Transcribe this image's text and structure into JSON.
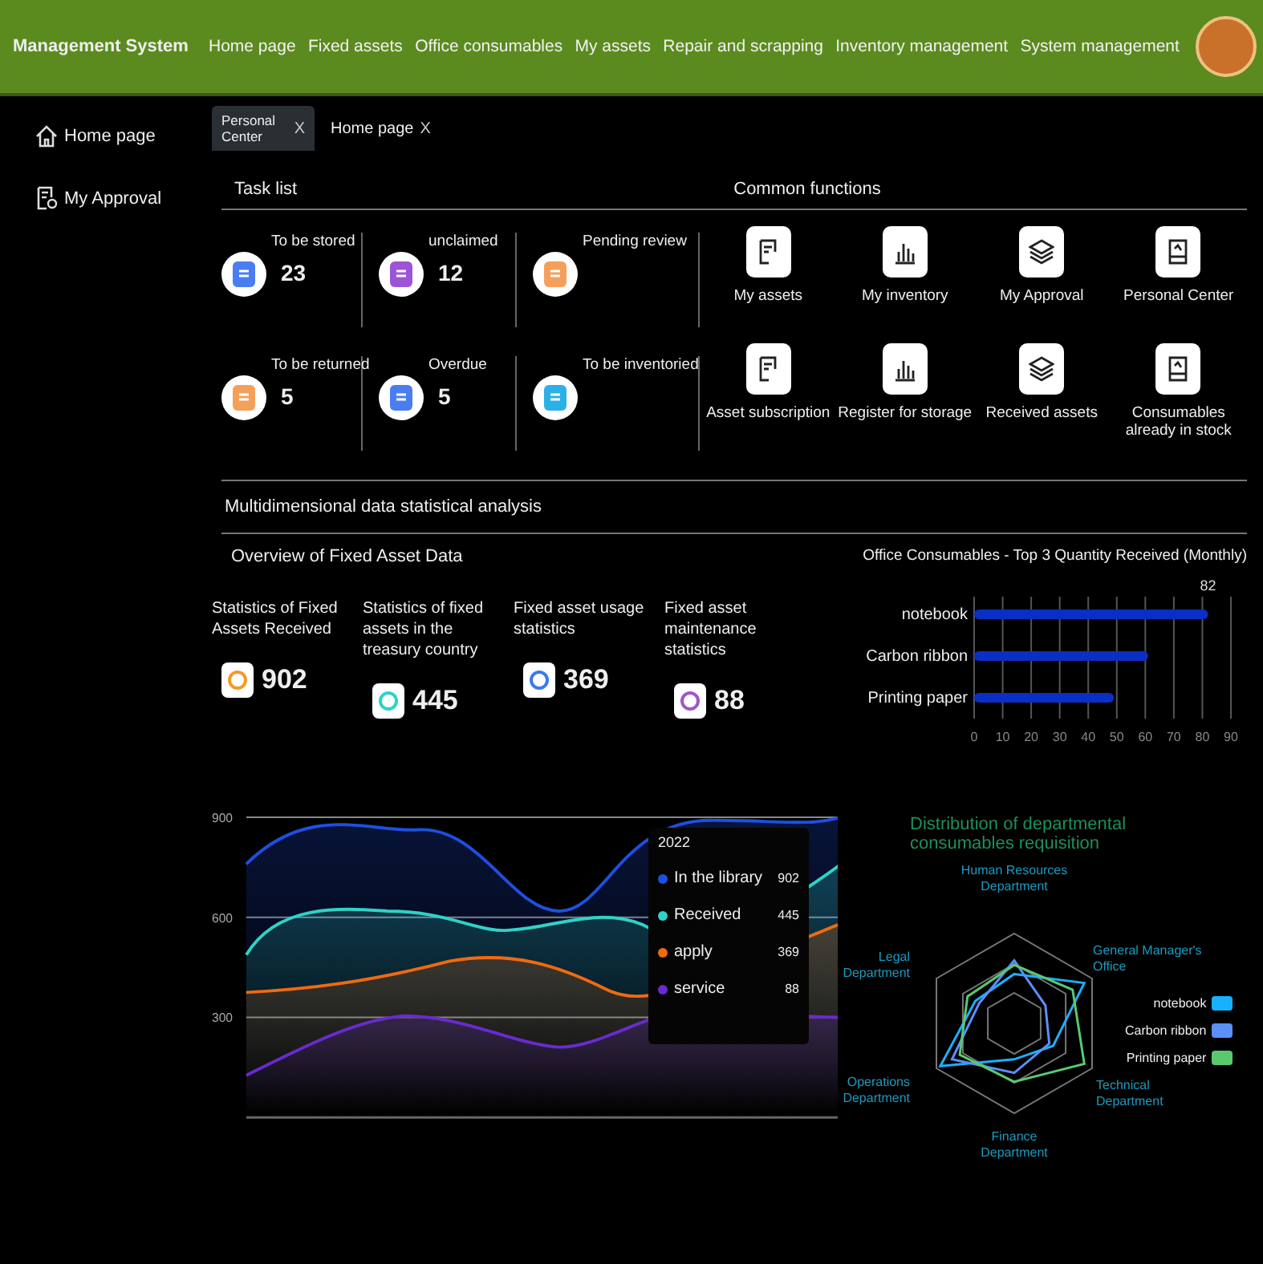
{
  "header": {
    "title": "Management System",
    "nav": [
      "Home page",
      "Fixed assets",
      "Office consumables",
      "My assets",
      "Repair and scrapping",
      "Inventory management",
      "System management"
    ]
  },
  "sidebar": {
    "items": [
      "Home page",
      "My Approval"
    ]
  },
  "tabs": [
    {
      "label": "Personal Center",
      "close": "X",
      "selected": true
    },
    {
      "label": "Home page",
      "close": "X",
      "selected": false
    }
  ],
  "task_list": {
    "title": "Task list",
    "items": [
      {
        "label": "To be stored",
        "count": "23",
        "color": "#4a7ef0"
      },
      {
        "label": "unclaimed",
        "count": "12",
        "color": "#9b55d6"
      },
      {
        "label": "Pending review",
        "color": "#f5a05a"
      },
      {
        "label": "To be returned",
        "count": "5",
        "color": "#f5a05a"
      },
      {
        "label": "Overdue",
        "count": "5",
        "color": "#4a7ef0"
      },
      {
        "label": "To be inventoried",
        "color": "#2bb0e8"
      }
    ]
  },
  "common_functions": {
    "title": "Common functions",
    "items": [
      "My assets",
      "My inventory",
      "My Approval",
      "Personal  Center",
      "Asset subscription",
      "Register for storage",
      "Received assets",
      "Consumables already in stock"
    ]
  },
  "section_title": "Multidimensional data statistical analysis",
  "overview": {
    "title": "Overview of Fixed Asset Data",
    "stats": [
      {
        "label": "Statistics of Fixed Assets Received",
        "value": "902",
        "color": "#f59a23"
      },
      {
        "label": "Statistics of fixed assets in the treasury country",
        "value": "445",
        "color": "#2ed3c6"
      },
      {
        "label": "Fixed asset usage statistics",
        "value": "369",
        "color": "#3a7af0"
      },
      {
        "label": "Fixed asset maintenance statistics",
        "value": "88",
        "color": "#9b55d6"
      }
    ]
  },
  "top3": {
    "chart_data": {
      "type": "bar",
      "orientation": "horizontal",
      "title": "Office Consumables - Top 3 Quantity Received (Monthly)",
      "categories": [
        "notebook",
        "Carbon ribbon",
        "Printing paper"
      ],
      "series": [
        {
          "color": "#0a2fc4",
          "values": [
            82,
            61,
            49
          ]
        }
      ],
      "xlim": [
        0,
        90
      ],
      "xticks": [
        0,
        10,
        20,
        30,
        40,
        50,
        60,
        70,
        80,
        90
      ],
      "grid": true,
      "annotations": [
        "82"
      ]
    }
  },
  "trend_chart": {
    "yticks": [
      "900",
      "600",
      "300"
    ],
    "tooltip": {
      "title": "2022",
      "items": [
        {
          "name": "In the library",
          "value": "902",
          "color": "#1f4fe0"
        },
        {
          "name": "Received",
          "value": "445",
          "color": "#2ed3c6"
        },
        {
          "name": "apply",
          "value": "369",
          "color": "#f06a10"
        },
        {
          "name": "service",
          "value": "88",
          "color": "#6a2ad0"
        }
      ]
    }
  },
  "radar": {
    "title": "Distribution of departmental consumables requisition",
    "axes": [
      "Human Resources Department",
      "Legal Department",
      "General Manager's Office",
      "Operations Department",
      "Technical Department",
      "Finance Department"
    ],
    "legend": [
      {
        "name": "notebook",
        "color": "#1ab0ff"
      },
      {
        "name": "Carbon ribbon",
        "color": "#5b8ff9"
      },
      {
        "name": "Printing paper",
        "color": "#5ac96e"
      }
    ]
  }
}
